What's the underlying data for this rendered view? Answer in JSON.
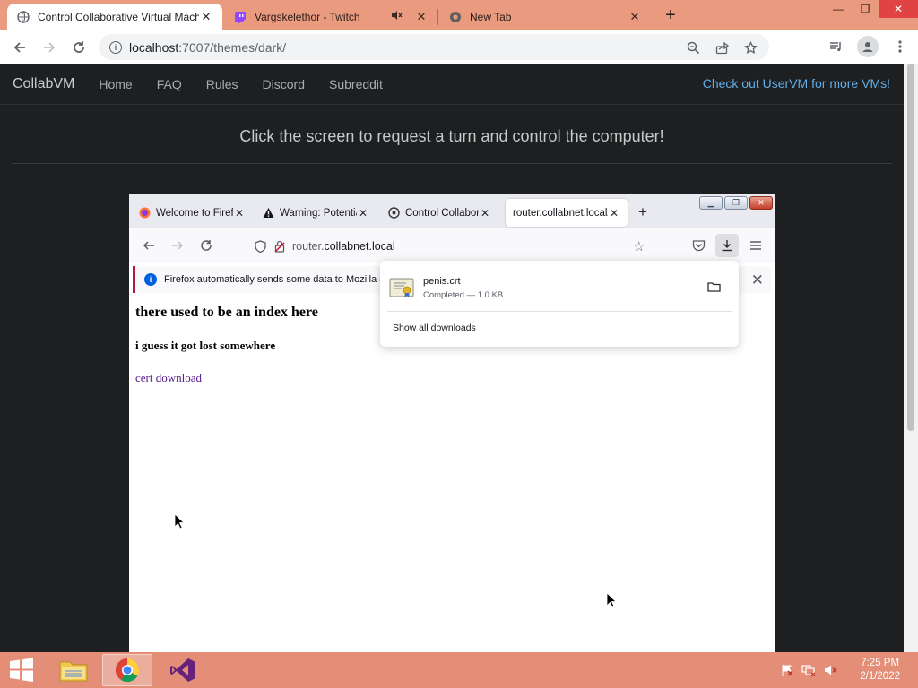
{
  "chrome": {
    "tabs": [
      {
        "title": "Control Collaborative Virtual Machine",
        "icon": "globe-icon",
        "active": true
      },
      {
        "title": "Vargskelethor - Twitch",
        "icon": "twitch-icon",
        "active": false,
        "muted": true
      },
      {
        "title": "New Tab",
        "icon": "chrome-icon",
        "active": false
      }
    ],
    "url_host": "localhost",
    "url_path": ":7007/themes/dark/"
  },
  "collabvm": {
    "brand": "CollabVM",
    "nav": [
      "Home",
      "FAQ",
      "Rules",
      "Discord",
      "Subreddit"
    ],
    "promo": "Check out UserVM for more VMs!",
    "prompt": "Click the screen to request a turn and control the computer!"
  },
  "vm": {
    "firefox": {
      "tabs": [
        {
          "title": "Welcome to Firefox",
          "icon": "firefox-icon",
          "active": false
        },
        {
          "title": "Warning: Potential Security Risk Ahead",
          "icon": "warning-icon",
          "active": false
        },
        {
          "title": "Control Collaborative Virtual Machine",
          "icon": "collabvm-icon",
          "active": false
        },
        {
          "title": "router.collabnet.local/",
          "icon": "",
          "active": true
        }
      ],
      "url_prefix": "router.",
      "url_domain": "collabnet.local",
      "notice": "Firefox automatically sends some data to Mozilla so",
      "page": {
        "heading": "there used to be an index here",
        "subheading": "i guess it got lost somewhere",
        "link": "cert download"
      },
      "downloads": {
        "filename": "penis.crt",
        "status": "Completed — 1.0 KB",
        "show_all": "Show all downloads"
      }
    },
    "taskbar": {
      "time": "7:25 PM",
      "date": "2/1/2022"
    }
  },
  "colors": {
    "chrome_frame": "#ea9a7e",
    "page_bg": "#1e1f20",
    "promo_link": "#62aee8",
    "taskbar": "#e48e78"
  }
}
